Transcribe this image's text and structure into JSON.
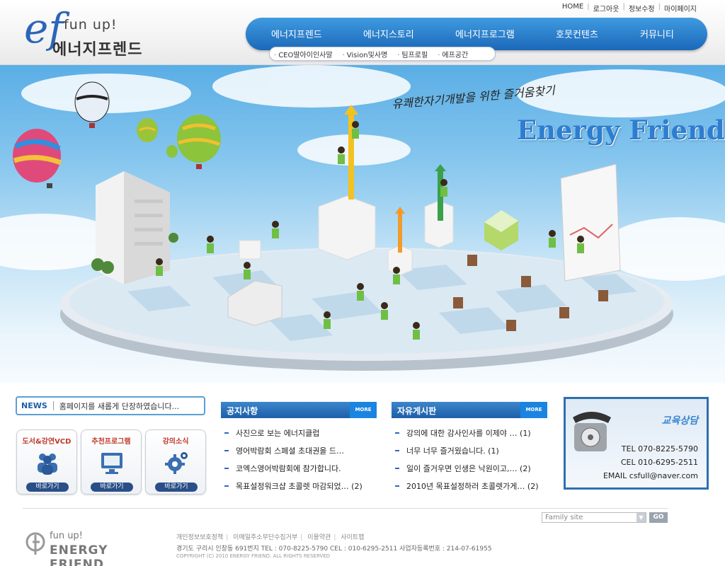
{
  "header": {
    "logo_mark": "ef",
    "logo_tagline": "fun up!",
    "logo_name": "에너지프렌드",
    "util_links": [
      "HOME",
      "로그아웃",
      "정보수정",
      "마이페이지"
    ],
    "gnb": [
      "에너지프렌드",
      "에너지스토리",
      "에너지프로그램",
      "호뭇컨텐츠",
      "커뮤니티"
    ],
    "lnb": [
      "CEO딸아이인사말",
      "Vision및사명",
      "팀프로필",
      "에프공간"
    ]
  },
  "hero": {
    "slogan": "유쾌한자기개발을 위한 즐거움찾기",
    "brand": "Energy Friend"
  },
  "news": {
    "label": "NEWS",
    "text": "홈페이지를 새롭게 단장하였습니다..."
  },
  "quick": [
    {
      "title": "도서&강연VCD",
      "button": "바로가기",
      "icon": "people-icon"
    },
    {
      "title": "추천프로그램",
      "button": "바로가기",
      "icon": "monitor-icon"
    },
    {
      "title": "강의소식",
      "button": "바로가기",
      "icon": "gear-icon"
    }
  ],
  "notice": {
    "title": "공지사항",
    "more": "MORE",
    "items": [
      "사진으로 보는 에너지클럽",
      "영어박람회 스페셜 초대권을 드…",
      "코엑스영어박람회에 참가합니다.",
      "목표설정워크샵 초콜렛 마감되었… (2)"
    ]
  },
  "freeboard": {
    "title": "자유게시판",
    "more": "MORE",
    "items": [
      "강의에 대한 감사인사를 이제야 … (1)",
      "너무 너무 즐거웠습니다. (1)",
      "일이 즐거우면 인생은 낙원이고,… (2)",
      "2010년 목표설정하러 초콜렛가게… (2)"
    ]
  },
  "consult": {
    "title": "교육상담",
    "tel": "TEL  070-8225-5790",
    "cel": "CEL  010-6295-2511",
    "email": "EMAIL  csfull@naver.com"
  },
  "footer": {
    "family_site": "Family site",
    "go": "GO",
    "logo_tagline": "fun up!",
    "logo_name": "ENERGY FRIEND",
    "links": [
      "개인정보보호정책",
      "이메일주소무단수집거부",
      "이용약관",
      "사이트맵"
    ],
    "address": "경기도 구리시 인창동 691번지 TEL : 070-8225-5790 CEL : 010-6295-2511  사업자등록번호 : 214-07-61955",
    "copyright": "COPYRIGHT (C) 2010 ENERGY FRIEND. ALL RIGHTS RESERVED"
  },
  "colors": {
    "primary": "#1b68b9",
    "accent": "#3f9be0",
    "notice_head": "#1c5fa8"
  }
}
